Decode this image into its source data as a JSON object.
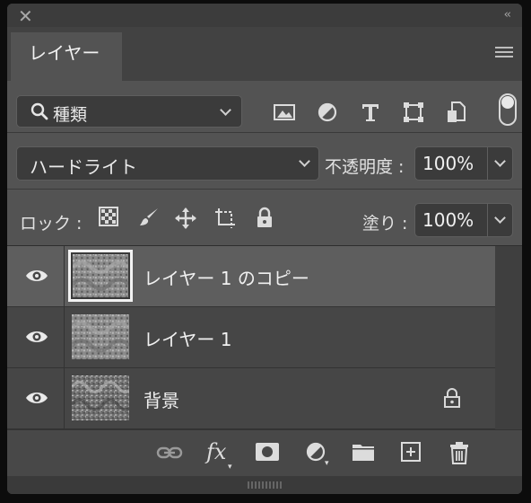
{
  "panel": {
    "tab_label": "レイヤー"
  },
  "filter": {
    "kind_label": "種類",
    "icons": [
      "image-filter-icon",
      "adjustment-filter-icon",
      "type-filter-icon",
      "shape-filter-icon",
      "smart-object-filter-icon"
    ]
  },
  "blend": {
    "mode": "ハードライト",
    "opacity_label": "不透明度 :",
    "opacity_value": "100%"
  },
  "lock": {
    "label": "ロック :",
    "fill_label": "塗り :",
    "fill_value": "100%"
  },
  "layers": [
    {
      "name": "レイヤー 1 のコピー",
      "selected": true,
      "visible": true,
      "locked": false
    },
    {
      "name": "レイヤー 1",
      "selected": false,
      "visible": true,
      "locked": false
    },
    {
      "name": "背景",
      "selected": false,
      "visible": true,
      "locked": true
    }
  ],
  "footer": {
    "fx_label": "fx"
  },
  "colors": {
    "panel_bg": "#535353",
    "selected_row": "#5e5e5e"
  }
}
